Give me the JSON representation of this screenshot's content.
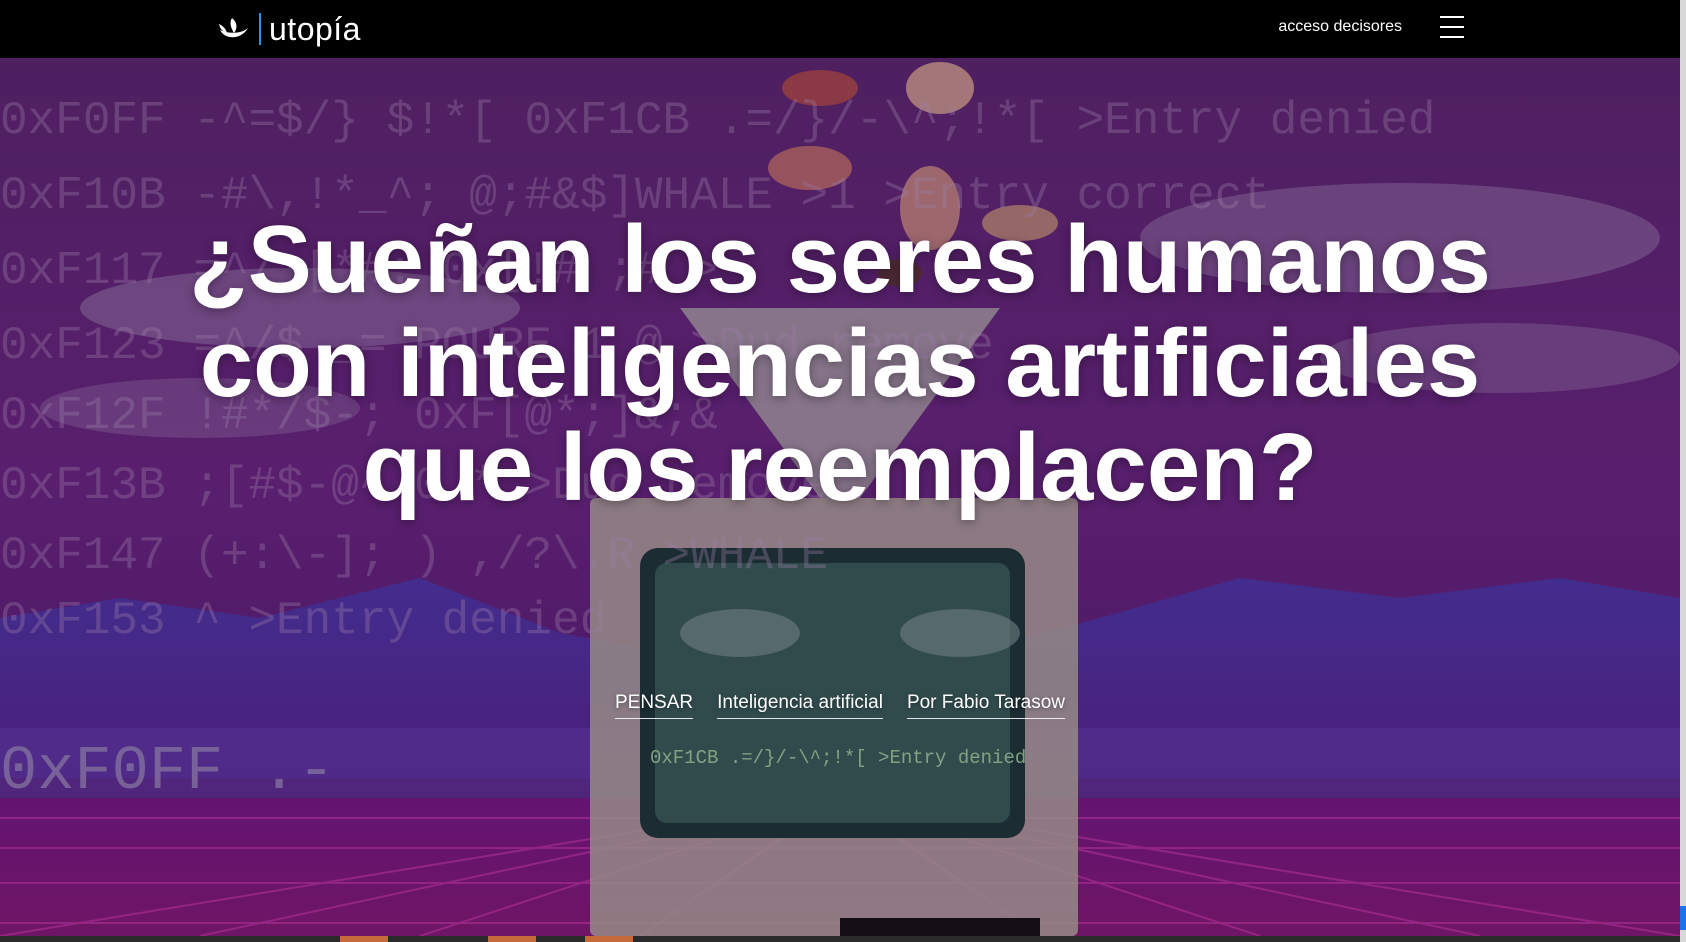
{
  "header": {
    "logo_text": "utopía",
    "access_label": "acceso decisores",
    "menu_icon": "hamburger-icon"
  },
  "hero": {
    "title": "¿Sueñan los seres humanos con inteligencias artificiales que los reemplacen?",
    "tags": [
      {
        "label": "PENSAR"
      },
      {
        "label": "Inteligencia artificial"
      },
      {
        "label": "Por Fabio Tarasow"
      }
    ],
    "background_text": {
      "rows": [
        "0xF0FF -^=$/} $!*[ 0xF1CB .=/}/-\\^;!*[ >Entry denied",
        "0xF10B -#\\,!*_^;  @;#&$]WHALE  >1 >Entry correct",
        "0xF117 =^/ [*#: 0x[!# ;# >",
        "0xF123 =^/$ _= POURE 1 @ >Dud remove",
        "0xF12F !#*/$-; 0xF[@*;]&;&",
        "0xF13B ;[#$-@^ 0 * >Dud remove",
        "0xF147 (+:\\-]; ) ,/?\\.R >WHALE",
        "0xF153 ^ >Entry denied",
        "0xF0FF .-"
      ],
      "screen_text": "0xF1CB .=/}/-\\^;!*[ >Entry denied"
    }
  },
  "colors": {
    "nav_bg": "#000000",
    "accent": "#2f8fe0",
    "hero_purple": "#6a2583",
    "text": "#ffffff"
  }
}
